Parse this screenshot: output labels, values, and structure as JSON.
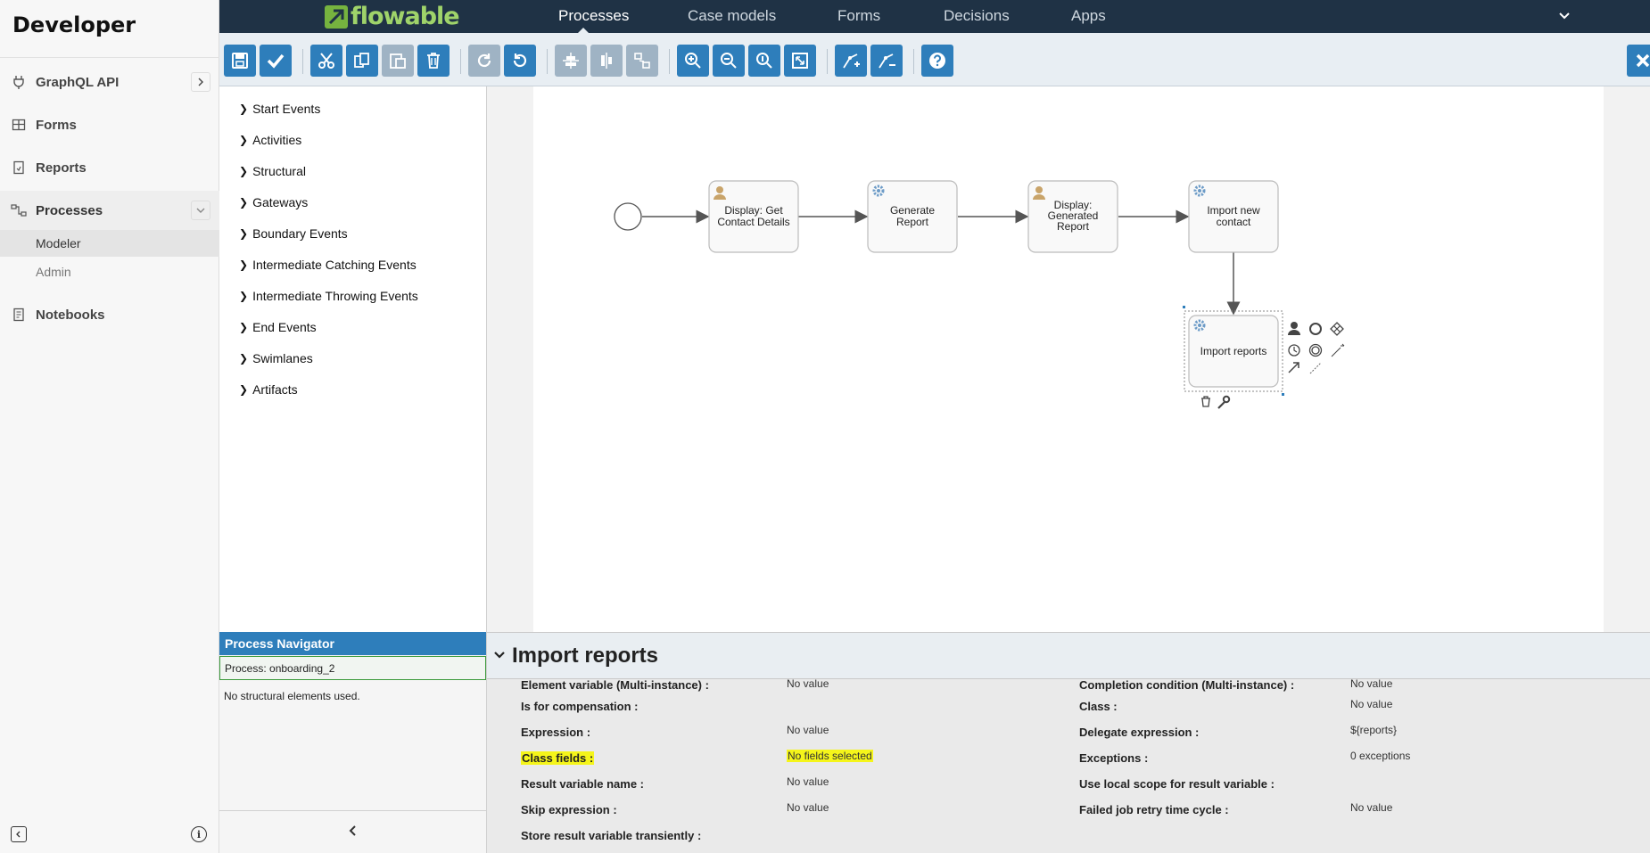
{
  "app": {
    "title": "Developer",
    "nav": [
      {
        "label": "GraphQL API",
        "icon": "plug-icon"
      },
      {
        "label": "Forms",
        "icon": "table-icon"
      },
      {
        "label": "Reports",
        "icon": "report-icon"
      },
      {
        "label": "Processes",
        "icon": "process-icon"
      },
      {
        "label": "Notebooks",
        "icon": "notebook-icon"
      }
    ],
    "processes_sub": [
      "Modeler",
      "Admin"
    ]
  },
  "topbar": {
    "logo": "flowable",
    "tabs": [
      "Processes",
      "Case models",
      "Forms",
      "Decisions",
      "Apps"
    ],
    "active_tab": "Processes"
  },
  "toolbar": {
    "buttons": [
      "save-icon",
      "validate-icon",
      "cut-icon",
      "copy-icon",
      "paste-icon",
      "delete-icon",
      "redo-icon",
      "undo-icon",
      "align-horizontal-icon",
      "align-vertical-icon",
      "same-size-icon",
      "zoom-in-icon",
      "zoom-out-icon",
      "zoom-actual-icon",
      "zoom-fit-icon",
      "add-bendpoint-icon",
      "remove-bendpoint-icon",
      "help-icon"
    ]
  },
  "palette": {
    "groups": [
      "Start Events",
      "Activities",
      "Structural",
      "Gateways",
      "Boundary Events",
      "Intermediate Catching Events",
      "Intermediate Throwing Events",
      "End Events",
      "Swimlanes",
      "Artifacts"
    ]
  },
  "diagram": {
    "tasks": [
      {
        "type": "user",
        "lines": [
          "Display: Get",
          "Contact Details"
        ]
      },
      {
        "type": "service",
        "lines": [
          "Generate",
          "Report"
        ]
      },
      {
        "type": "user",
        "lines": [
          "Display:",
          "Generated",
          "Report"
        ]
      },
      {
        "type": "service",
        "lines": [
          "Import new",
          "contact"
        ]
      },
      {
        "type": "service",
        "lines": [
          "Import reports"
        ]
      }
    ]
  },
  "navigator": {
    "header": "Process Navigator",
    "process": "Process: onboarding_2",
    "empty_text": "No structural elements used."
  },
  "properties": {
    "title": "Import reports",
    "left": [
      {
        "label": "Element variable (Multi-instance) :",
        "value": "No value"
      },
      {
        "label": "Is for compensation :",
        "value": ""
      },
      {
        "label": "Expression :",
        "value": "No value"
      },
      {
        "label": "Class fields :",
        "value": "No fields selected"
      },
      {
        "label": "Result variable name :",
        "value": "No value"
      },
      {
        "label": "Skip expression :",
        "value": "No value"
      },
      {
        "label": "Store result variable transiently :",
        "value": ""
      }
    ],
    "right": [
      {
        "label": "Completion condition (Multi-instance) :",
        "value": "No value"
      },
      {
        "label": "Class :",
        "value": "No value"
      },
      {
        "label": "Delegate expression :",
        "value": "${reports}"
      },
      {
        "label": "Exceptions :",
        "value": "0 exceptions"
      },
      {
        "label": "Use local scope for result variable :",
        "value": ""
      },
      {
        "label": "Failed job retry time cycle :",
        "value": "No value"
      }
    ]
  }
}
